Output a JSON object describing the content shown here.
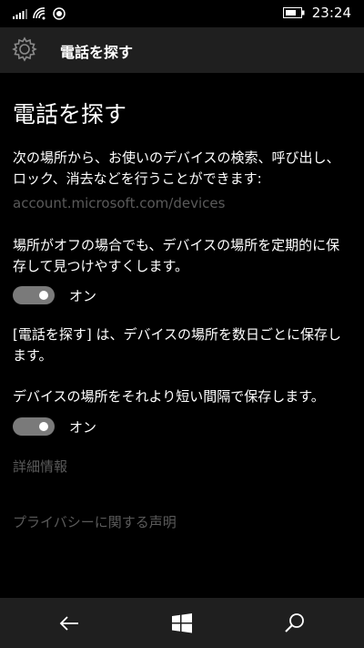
{
  "status": {
    "time": "23:24"
  },
  "header": {
    "title": "電話を探す"
  },
  "main": {
    "title": "電話を探す",
    "description": "次の場所から、お使いのデバイスの検索、呼び出し、ロック、消去などを行うことができます:",
    "url": "account.microsoft.com/devices",
    "periodic_text": "場所がオフの場合でも、デバイスの場所を定期的に保存して見つけやすくします。",
    "toggle1_label": "オン",
    "info_text": "[電話を探す] は、デバイスの場所を数日ごとに保存します。",
    "short_interval_text": " デバイスの場所をそれより短い間隔で保存します。",
    "toggle2_label": "オン",
    "details_link": "詳細情報",
    "privacy_link": "プライバシーに関する声明"
  },
  "toggles": {
    "periodic_save": true,
    "short_interval": true
  },
  "icons": {
    "signal": "signal-icon",
    "wifi": "wifi-icon",
    "sync": "sync-icon",
    "battery": "battery-icon",
    "settings": "gear-icon",
    "back": "back-arrow-icon",
    "start": "windows-start-icon",
    "search": "search-icon"
  },
  "colors": {
    "background": "#000000",
    "header": "#1f1f1f",
    "toggle_track": "#7a7a7a",
    "dim_text": "#5a5a5a"
  }
}
